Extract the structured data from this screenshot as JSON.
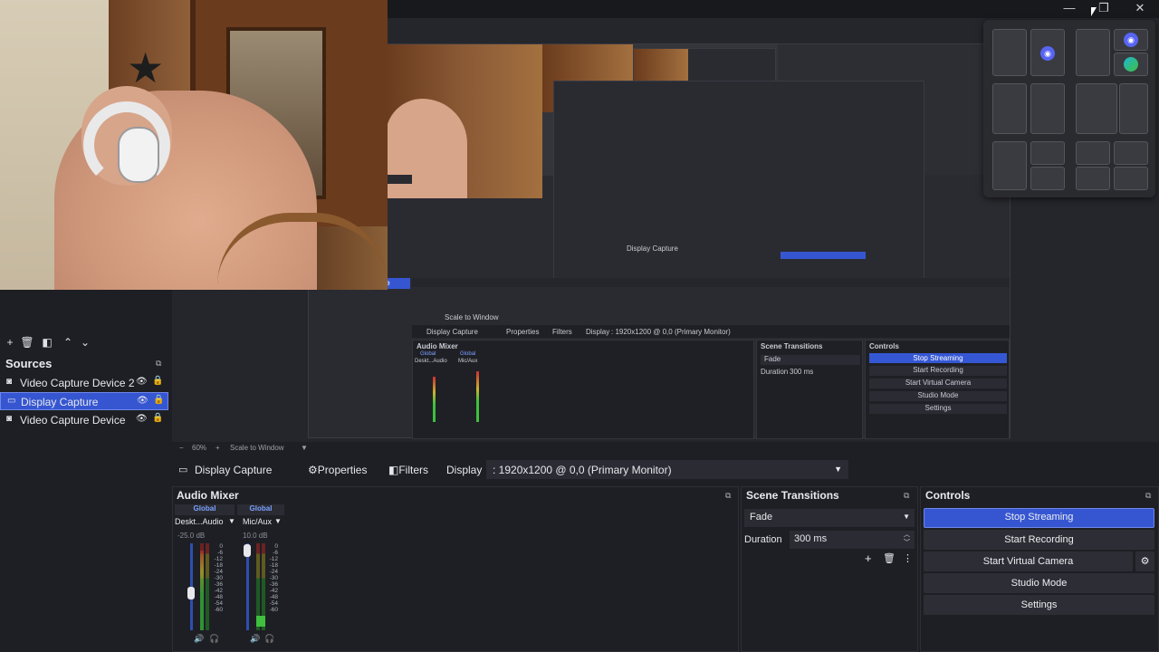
{
  "window": {
    "minimize_label": "—",
    "restore_label": "❐",
    "close_label": "✕"
  },
  "scenes_toolbar": {
    "add": "+",
    "remove": "🗑",
    "filter": "◧",
    "up": "⌃",
    "down": "⌄"
  },
  "sources": {
    "title": "Sources",
    "items": [
      {
        "label": "Video Capture Device 2",
        "icon": "camera-icon",
        "selected": false
      },
      {
        "label": "Display Capture",
        "icon": "monitor-icon",
        "selected": true
      },
      {
        "label": "Video Capture Device",
        "icon": "camera-icon",
        "selected": false
      }
    ]
  },
  "preview": {
    "nested_source_label": "Video Capture Device",
    "nested_scale_label": "Scale to Window",
    "nested_display": "Display Capture",
    "nested_properties": "Properties",
    "nested_filters": "Filters",
    "nested_display_label": "Display",
    "nested_display_value": ": 1920x1200 @ 0,0 (Primary Monitor)",
    "nested_audio": "Audio Mixer",
    "nested_transitions": "Scene Transitions",
    "nested_controls": "Controls",
    "nested_fade": "Fade",
    "nested_duration": "Duration",
    "nested_duration_val": "300 ms",
    "nested_global": "Global",
    "nested_desktop": "Deskt...Audio",
    "nested_mic": "Mic/Aux"
  },
  "zoom": {
    "minus": "−",
    "percent": "60%",
    "plus": "+",
    "mode": "Scale to Window"
  },
  "context": {
    "source_name": "Display Capture",
    "properties": "Properties",
    "filters": "Filters",
    "display_label": "Display",
    "display_value": ": 1920x1200 @ 0,0 (Primary Monitor)"
  },
  "audio_mixer": {
    "title": "Audio Mixer",
    "channels": [
      {
        "scope": "Global",
        "name": "Deskt...Audio",
        "db": "-25.0 dB",
        "level": 0.35
      },
      {
        "scope": "Global",
        "name": "Mic/Aux",
        "db": "10.0 dB",
        "level": 0.95
      }
    ],
    "scale": [
      "0",
      "-6",
      "-12",
      "-18",
      "-24",
      "-30",
      "-36",
      "-42",
      "-48",
      "-54",
      "-60"
    ]
  },
  "scene_transitions": {
    "title": "Scene Transitions",
    "transition": "Fade",
    "duration_label": "Duration",
    "duration_value": "300 ms"
  },
  "controls": {
    "title": "Controls",
    "stop_streaming": "Stop Streaming",
    "start_recording": "Start Recording",
    "start_virtual_camera": "Start Virtual Camera",
    "studio_mode": "Studio Mode",
    "settings": "Settings"
  },
  "colors": {
    "accent": "#3656d1",
    "panel": "#1e1f24",
    "meter_green": "#3fbf3f",
    "meter_yellow": "#c8b430",
    "meter_red": "#c83030"
  }
}
